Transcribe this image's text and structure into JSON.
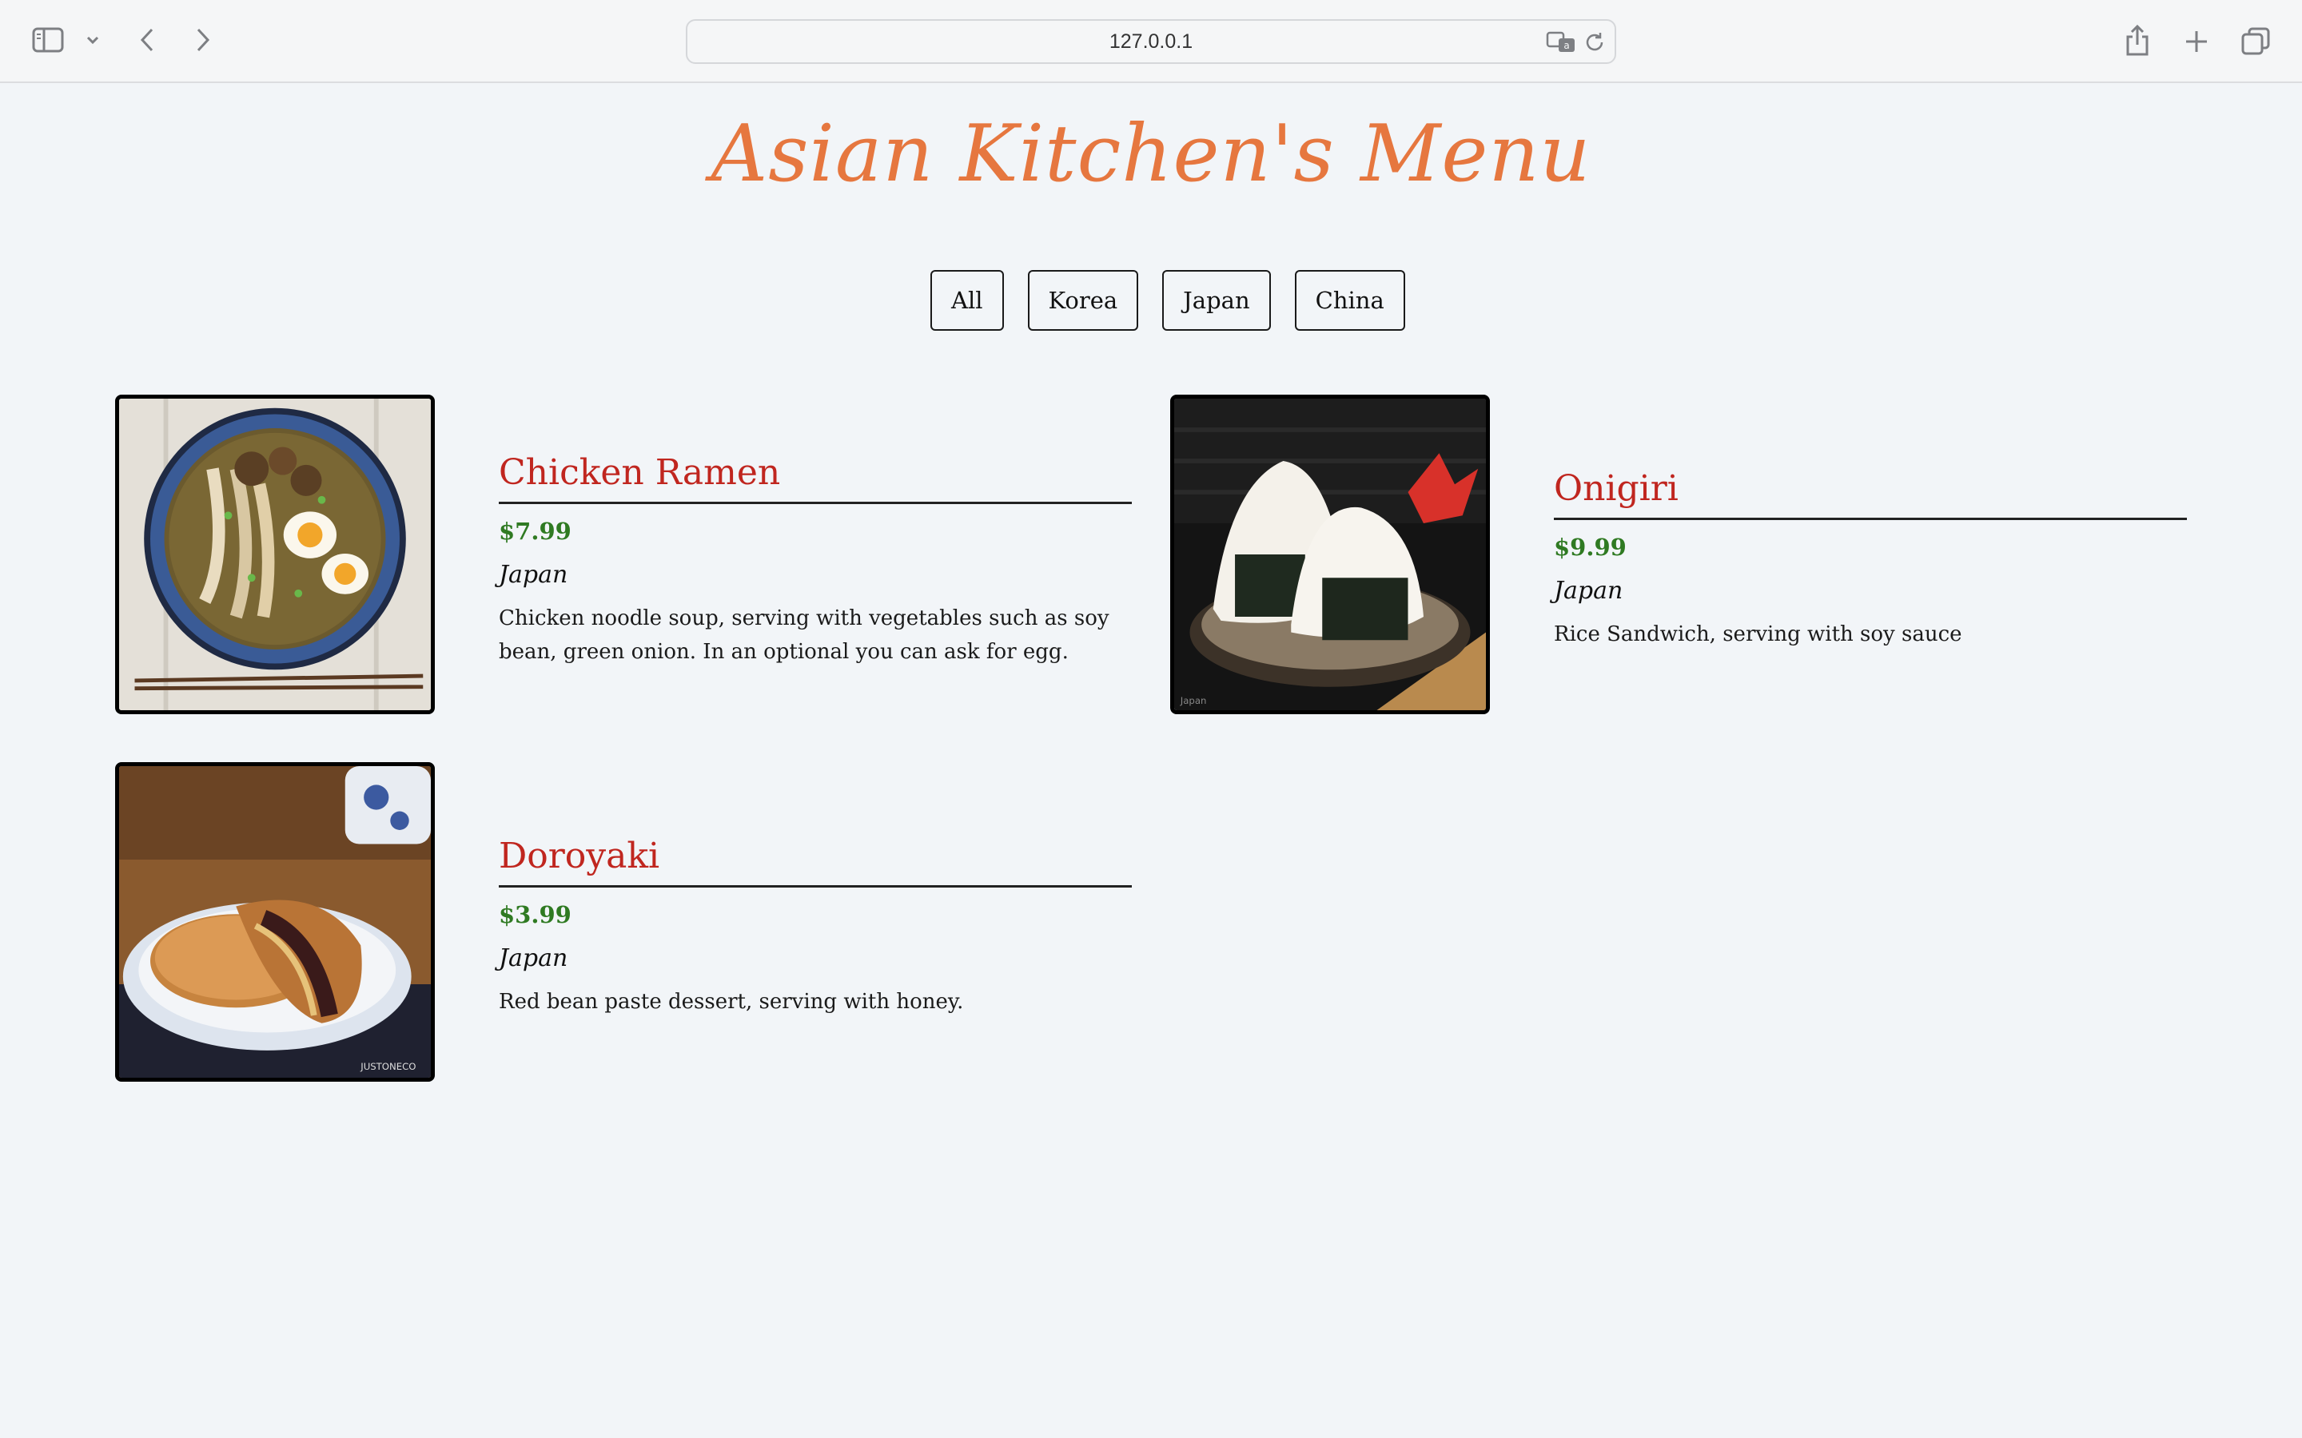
{
  "browser": {
    "url": "127.0.0.1"
  },
  "page": {
    "title": "Asian Kitchen's Menu"
  },
  "filters": [
    "All",
    "Korea",
    "Japan",
    "China"
  ],
  "menu": [
    {
      "name": "Chicken Ramen",
      "price": "$7.99",
      "origin": "Japan",
      "description": "Chicken noodle soup, serving with vegetables such as soy bean, green onion. In an optional you can ask for egg.",
      "image": "ramen-bowl-photo"
    },
    {
      "name": "Onigiri",
      "price": "$9.99",
      "origin": "Japan",
      "description": "Rice Sandwich, serving with soy sauce",
      "image": "onigiri-photo"
    },
    {
      "name": "Doroyaki",
      "price": "$3.99",
      "origin": "Japan",
      "description": "Red bean paste dessert, serving with honey.",
      "image": "dorayaki-photo"
    }
  ]
}
